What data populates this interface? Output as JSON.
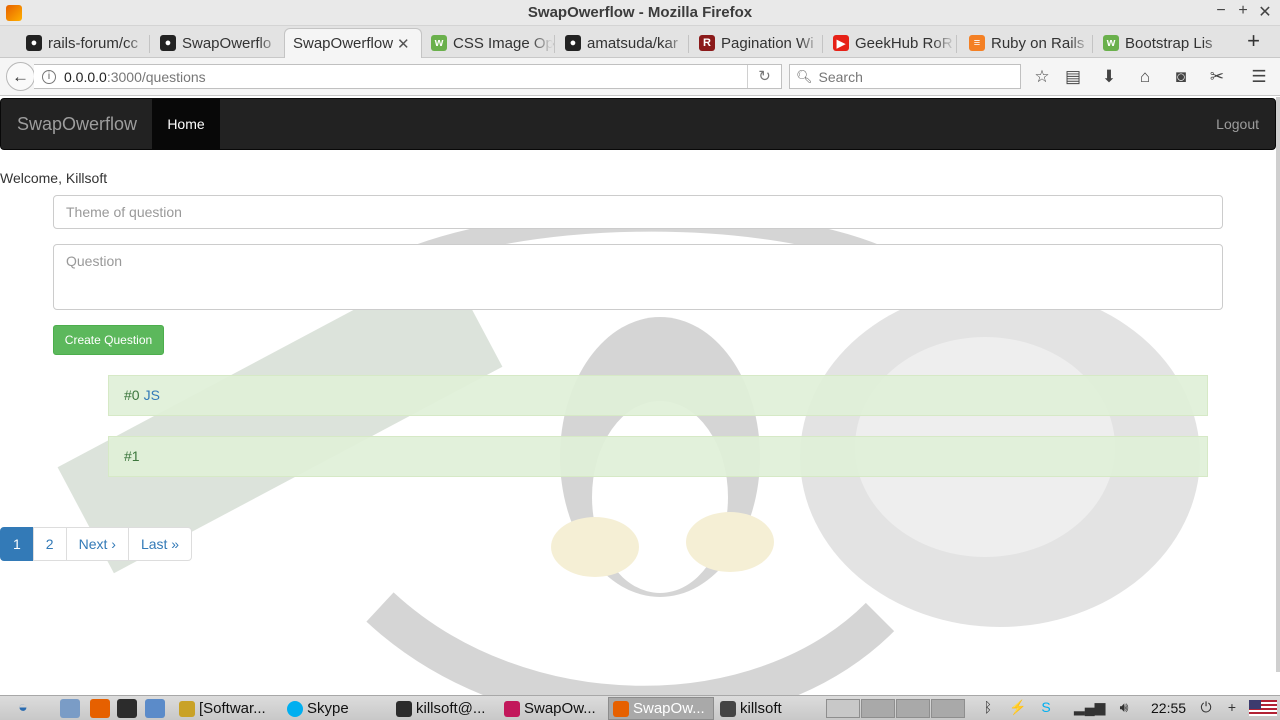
{
  "window": {
    "title": "SwapOwerflow - Mozilla Firefox",
    "controls": [
      "−",
      "+",
      "✕"
    ]
  },
  "tabs": [
    {
      "label": "rails-forum/cc",
      "icon": "github-icon"
    },
    {
      "label": "SwapOwerflo",
      "icon": "github-icon"
    },
    {
      "label": "SwapOwerflow",
      "icon": "",
      "active": true
    },
    {
      "label": "CSS Image Op",
      "icon": "w3-icon"
    },
    {
      "label": "amatsuda/kar",
      "icon": "github-icon"
    },
    {
      "label": "Pagination Wi",
      "icon": "railscasts-icon"
    },
    {
      "label": "GeekHub RoR",
      "icon": "youtube-icon"
    },
    {
      "label": "Ruby on Rails",
      "icon": "stackoverflow-icon"
    },
    {
      "label": "Bootstrap Lis",
      "icon": "w3-icon"
    }
  ],
  "urlbar": {
    "host": "0.0.0.0",
    "path": ":3000/questions"
  },
  "searchbar": {
    "placeholder": "Search"
  },
  "app": {
    "brand": "SwapOwerflow",
    "nav_home": "Home",
    "nav_logout": "Logout",
    "welcome": "Welcome, Killsoft",
    "theme_placeholder": "Theme of question",
    "question_placeholder": "Question",
    "create_button": "Create Question",
    "questions": [
      {
        "number": "#0",
        "title": "JS"
      },
      {
        "number": "#1",
        "title": ""
      }
    ],
    "pagination": {
      "current": "1",
      "page2": "2",
      "next": "Next ›",
      "last": "Last »"
    }
  },
  "taskbar": {
    "tasks": [
      {
        "label": "[Softwar...",
        "icon": "software-icon"
      },
      {
        "label": "Skype",
        "icon": "skype-icon"
      },
      {
        "label": "killsoft@...",
        "icon": "terminal-icon"
      },
      {
        "label": "SwapOw...",
        "icon": "rubymine-icon"
      },
      {
        "label": "SwapOw...",
        "icon": "firefox-icon",
        "active": true
      },
      {
        "label": "killsoft",
        "icon": "folder-icon"
      }
    ],
    "clock": "22:55"
  },
  "colors": {
    "navbar_bg": "#222222",
    "success_green": "#5cb85c",
    "link_blue": "#337ab7",
    "list_success_bg": "#dff0d8"
  }
}
